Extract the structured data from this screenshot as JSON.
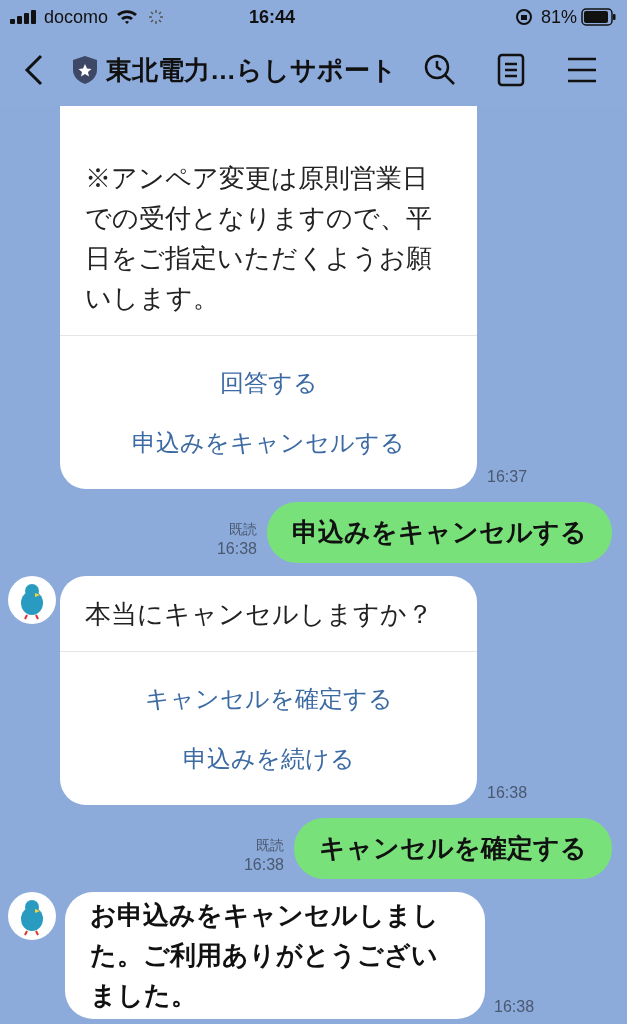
{
  "status_bar": {
    "carrier": "docomo",
    "time": "16:44",
    "battery": "81%"
  },
  "header": {
    "title": "東北電力…らしサポート"
  },
  "messages": [
    {
      "kind": "card",
      "paragraphs": [
        "※アンペア変更は原則営業日での受付となりますので、平日をご指定いただくようお願いします。"
      ],
      "actions": [
        "回答する",
        "申込みをキャンセルする"
      ],
      "time": "16:37"
    },
    {
      "kind": "outgoing",
      "text": "申込みをキャンセルする",
      "read": "既読",
      "time": "16:38"
    },
    {
      "kind": "card",
      "avatar": true,
      "paragraphs": [
        "本当にキャンセルしますか？"
      ],
      "actions": [
        "キャンセルを確定する",
        "申込みを続ける"
      ],
      "time": "16:38"
    },
    {
      "kind": "outgoing",
      "text": "キャンセルを確定する",
      "read": "既読",
      "time": "16:38"
    },
    {
      "kind": "incoming",
      "avatar": true,
      "text": "お申込みをキャンセルしました。ご利用ありがとうございました。",
      "time": "16:38"
    }
  ]
}
